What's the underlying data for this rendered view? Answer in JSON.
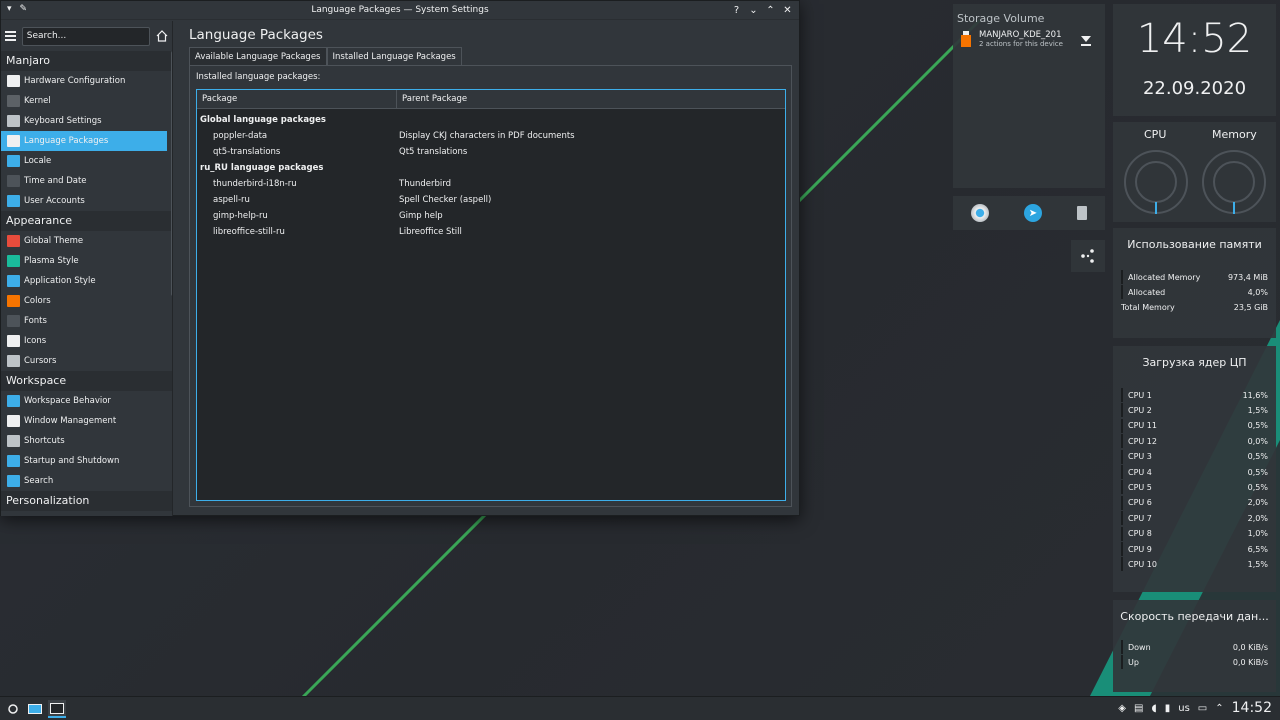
{
  "window": {
    "title": "Language Packages — System Settings",
    "controls": [
      "?",
      "⌄",
      "⌃",
      "✕"
    ]
  },
  "sidebar": {
    "search_placeholder": "Search...",
    "categories": [
      {
        "label": "Manjaro",
        "items": [
          {
            "label": "Hardware Configuration",
            "icon": "hardware-icon",
            "color": "#eff0f1"
          },
          {
            "label": "Kernel",
            "icon": "kernel-icon",
            "color": "#5c6166"
          },
          {
            "label": "Keyboard Settings",
            "icon": "keyboard-icon",
            "color": "#bdc3c7"
          },
          {
            "label": "Language Packages",
            "icon": "language-icon",
            "color": "#eff0f1",
            "active": true
          },
          {
            "label": "Locale",
            "icon": "locale-icon",
            "color": "#3daee9"
          },
          {
            "label": "Time and Date",
            "icon": "clock-icon",
            "color": "#4d5359"
          },
          {
            "label": "User Accounts",
            "icon": "user-icon",
            "color": "#3daee9"
          }
        ]
      },
      {
        "label": "Appearance",
        "items": [
          {
            "label": "Global Theme",
            "icon": "global-theme-icon",
            "color": "#e74c3c"
          },
          {
            "label": "Plasma Style",
            "icon": "plasma-style-icon",
            "color": "#1abc9c"
          },
          {
            "label": "Application Style",
            "icon": "app-style-icon",
            "color": "#3daee9"
          },
          {
            "label": "Colors",
            "icon": "colors-icon",
            "color": "#f67400"
          },
          {
            "label": "Fonts",
            "icon": "fonts-icon",
            "color": "#4d5359"
          },
          {
            "label": "Icons",
            "icon": "icons-icon",
            "color": "#eff0f1"
          },
          {
            "label": "Cursors",
            "icon": "cursor-icon",
            "color": "#bdc3c7"
          }
        ]
      },
      {
        "label": "Workspace",
        "items": [
          {
            "label": "Workspace Behavior",
            "icon": "workspace-icon",
            "color": "#3daee9"
          },
          {
            "label": "Window Management",
            "icon": "window-icon",
            "color": "#eff0f1"
          },
          {
            "label": "Shortcuts",
            "icon": "shortcuts-icon",
            "color": "#bdc3c7"
          },
          {
            "label": "Startup and Shutdown",
            "icon": "startup-icon",
            "color": "#3daee9"
          },
          {
            "label": "Search",
            "icon": "search-icon",
            "color": "#3daee9"
          }
        ]
      },
      {
        "label": "Personalization",
        "items": []
      }
    ]
  },
  "content": {
    "heading": "Language Packages",
    "tabs": [
      {
        "label": "Available Language Packages",
        "active": false
      },
      {
        "label": "Installed Language Packages",
        "active": true
      }
    ],
    "panel_label": "Installed language packages:",
    "columns": [
      "Package",
      "Parent Package"
    ],
    "rows": [
      {
        "group": true,
        "package": "Global language packages",
        "parent": ""
      },
      {
        "group": false,
        "package": "poppler-data",
        "parent": "Display CKJ characters in PDF documents"
      },
      {
        "group": false,
        "package": "qt5-translations",
        "parent": "Qt5 translations"
      },
      {
        "group": true,
        "package": "ru_RU language packages",
        "parent": ""
      },
      {
        "group": false,
        "package": "thunderbird-i18n-ru",
        "parent": "Thunderbird"
      },
      {
        "group": false,
        "package": "aspell-ru",
        "parent": "Spell Checker (aspell)"
      },
      {
        "group": false,
        "package": "gimp-help-ru",
        "parent": "Gimp help"
      },
      {
        "group": false,
        "package": "libreoffice-still-ru",
        "parent": "Libreoffice Still"
      }
    ]
  },
  "widgets": {
    "storage": {
      "title": "Storage Volume",
      "device": "MANJARO_KDE_201",
      "actions": "2 actions for this device"
    },
    "clock": {
      "time": "14:52",
      "date": "22.09.2020"
    },
    "gauges": {
      "cpu_label": "CPU",
      "memory_label": "Memory"
    },
    "memory": {
      "title": "Использование памяти",
      "rows": [
        {
          "label": "Allocated Memory",
          "value": "973,4 MiB"
        },
        {
          "label": "Allocated",
          "value": "4,0%"
        },
        {
          "label": "Total Memory",
          "value": "23,5 GiB"
        }
      ]
    },
    "cpu_cores": {
      "title": "Загрузка ядер ЦП",
      "rows": [
        {
          "label": "CPU 1",
          "value": "11,6%"
        },
        {
          "label": "CPU 2",
          "value": "1,5%"
        },
        {
          "label": "CPU 11",
          "value": "0,5%"
        },
        {
          "label": "CPU 12",
          "value": "0,0%"
        },
        {
          "label": "CPU 3",
          "value": "0,5%"
        },
        {
          "label": "CPU 4",
          "value": "0,5%"
        },
        {
          "label": "CPU 5",
          "value": "0,5%"
        },
        {
          "label": "CPU 6",
          "value": "2,0%"
        },
        {
          "label": "CPU 7",
          "value": "2,0%"
        },
        {
          "label": "CPU 8",
          "value": "1,0%"
        },
        {
          "label": "CPU 9",
          "value": "6,5%"
        },
        {
          "label": "CPU 10",
          "value": "1,5%"
        }
      ]
    },
    "network": {
      "title": "Скорость передачи дан...",
      "rows": [
        {
          "label": "Down",
          "value": "0,0 KiB/s"
        },
        {
          "label": "Up",
          "value": "0,0 KiB/s"
        }
      ]
    }
  },
  "taskbar": {
    "layout": "us",
    "time": "14:52"
  },
  "colors": {
    "accent": "#3daee9",
    "desktop_stripe": "#3aa657",
    "teal": "#16a085"
  }
}
